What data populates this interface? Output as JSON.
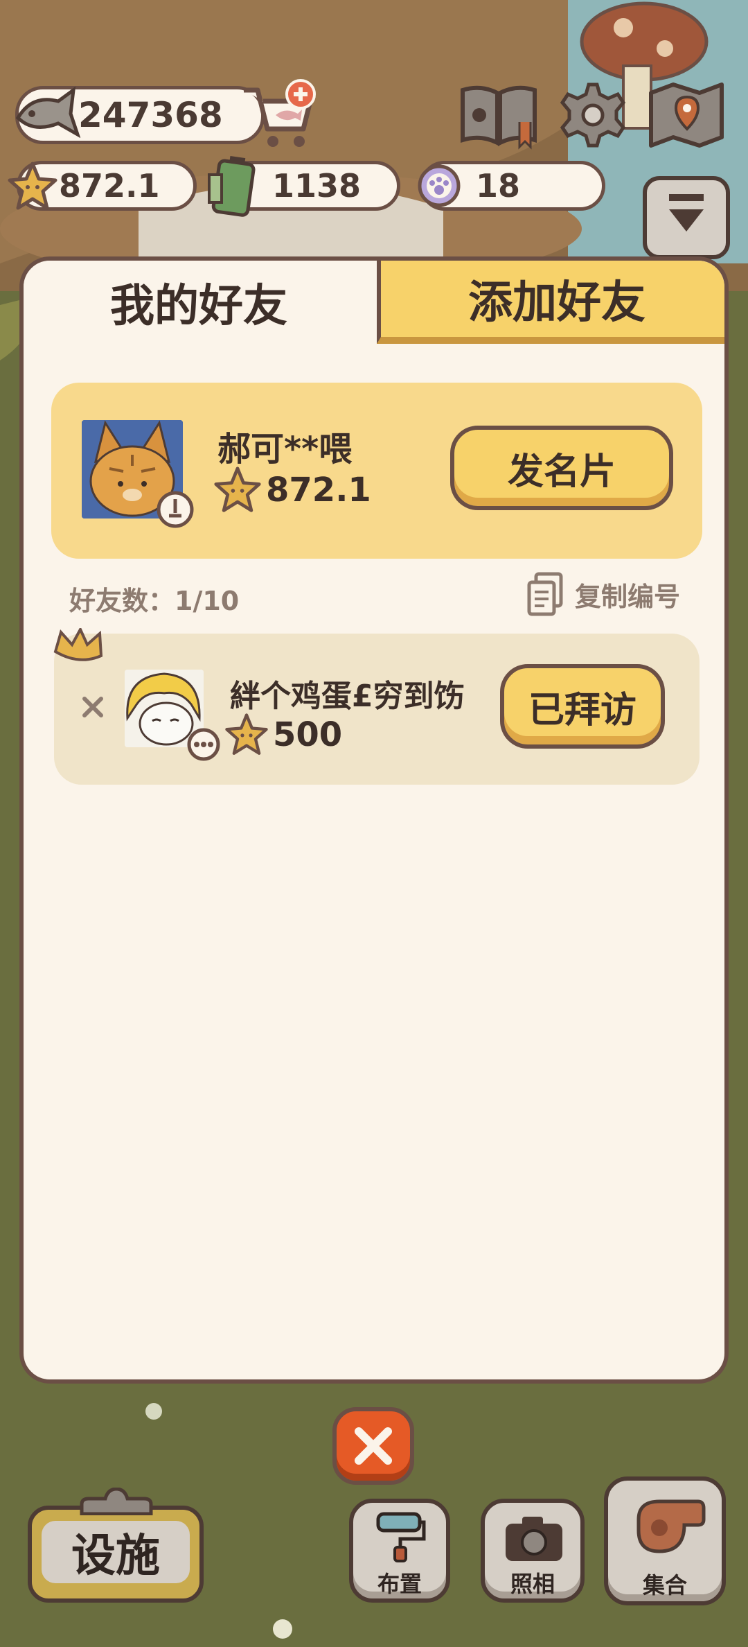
{
  "hud": {
    "fish_count": "247368",
    "star_rating": "872.1",
    "battery_count": "1138",
    "paw_coin_count": "18"
  },
  "tabs": {
    "my_friends": "我的好友",
    "add_friend": "添加好友"
  },
  "me": {
    "name": "郝可**喂",
    "rating": "872.1",
    "send_card_label": "发名片"
  },
  "friends_meta": {
    "count_label": "好友数：1/10",
    "copy_id_label": "复制编号"
  },
  "friends": [
    {
      "name": "絆个鸡蛋£穷到饬",
      "rating": "500",
      "action_label": "已拜访"
    }
  ],
  "bottom": {
    "facility_label": "设施",
    "layout_label": "布置",
    "photo_label": "照相",
    "gather_label": "集合"
  },
  "colors": {
    "panel_bg": "#fbf4ea",
    "border": "#6b4f45",
    "tab_inactive": "#f7d26a",
    "card_me_bg": "#f8d98c",
    "card_friend_bg": "#f0e4c9",
    "close_button": "#e55a26",
    "grass": "#6a6e3f"
  }
}
